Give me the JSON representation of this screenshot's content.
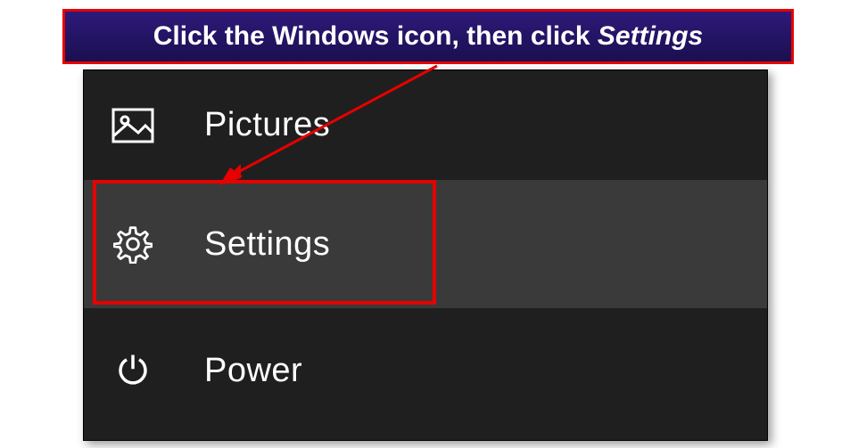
{
  "callout": {
    "text_plain": "Click the Windows icon, then click ",
    "text_emph": "Settings"
  },
  "menu": {
    "pictures": {
      "label": "Pictures"
    },
    "settings": {
      "label": "Settings"
    },
    "power": {
      "label": "Power"
    }
  },
  "icons": {
    "pictures": "pictures-icon",
    "settings": "gear-icon",
    "power": "power-icon"
  },
  "colors": {
    "panel_bg": "#1f1f1f",
    "hover_bg": "#3a3a3a",
    "highlight": "#e60000",
    "callout_bg": "#2e1a7a"
  }
}
